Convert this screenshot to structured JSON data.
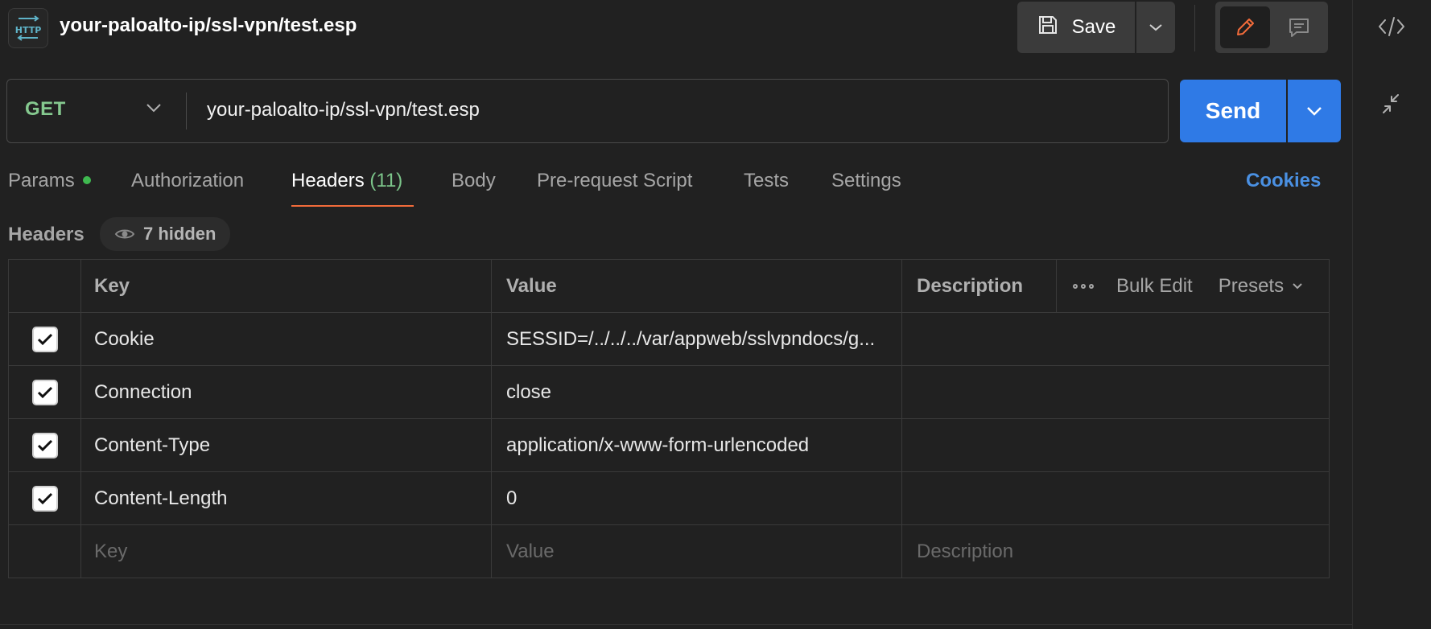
{
  "request": {
    "title": "your-paloalto-ip/ssl-vpn/test.esp",
    "method": "GET",
    "url": "your-paloalto-ip/ssl-vpn/test.esp"
  },
  "toolbar": {
    "save_label": "Save",
    "send_label": "Send"
  },
  "tabs": {
    "params": "Params",
    "authorization": "Authorization",
    "headers": "Headers",
    "headers_count": "(11)",
    "body": "Body",
    "prerequest": "Pre-request Script",
    "tests": "Tests",
    "settings": "Settings",
    "cookies": "Cookies"
  },
  "headers_section": {
    "title": "Headers",
    "hidden_label": "7 hidden"
  },
  "table": {
    "col_key": "Key",
    "col_value": "Value",
    "col_description": "Description",
    "bulk_edit": "Bulk Edit",
    "presets": "Presets",
    "rows": [
      {
        "key": "Cookie",
        "value": "SESSID=/../../../var/appweb/sslvpndocs/g...",
        "checked": true
      },
      {
        "key": "Connection",
        "value": "close",
        "checked": true
      },
      {
        "key": "Content-Type",
        "value": "application/x-www-form-urlencoded",
        "checked": true
      },
      {
        "key": "Content-Length",
        "value": "0",
        "checked": true
      }
    ],
    "placeholder": {
      "key": "Key",
      "value": "Value",
      "description": "Description"
    }
  },
  "colors": {
    "accent_send": "#2f7ae6",
    "method_get": "#85c98f",
    "tab_underline": "#f26b3a",
    "cookies_link": "#4a90e2",
    "params_dot": "#3fb950"
  }
}
